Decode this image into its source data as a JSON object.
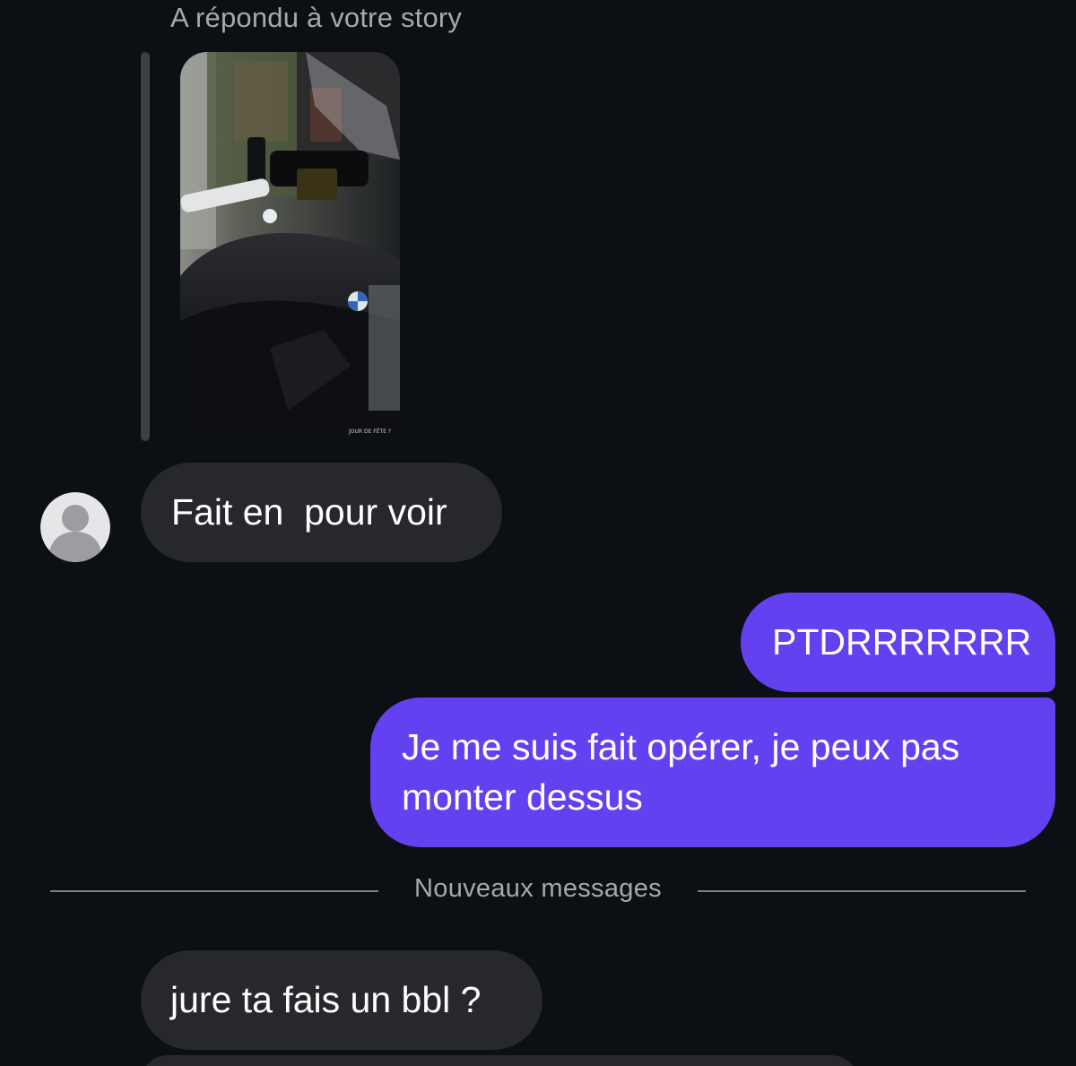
{
  "story_reply": {
    "caption": "A répondu à votre story",
    "thumbnail_icon": "motorcycle-story-image",
    "thumbnail_overlay_text": "JOUR DE FÊTE ?"
  },
  "avatar": {
    "icon": "default-user-avatar-icon"
  },
  "messages": [
    {
      "direction": "incoming",
      "text": "Fait en  pour voir"
    },
    {
      "direction": "outgoing",
      "text": "PTDRRRRRRR"
    },
    {
      "direction": "outgoing",
      "text": "Je me suis fait opérer, je peux pas\nmonter dessus"
    },
    {
      "direction": "incoming",
      "text": "jure ta fais un bbl ?"
    }
  ],
  "divider": {
    "label": "Nouveaux messages"
  },
  "colors": {
    "background": "#0c0f14",
    "incoming_bubble": "#26282c",
    "outgoing_bubble": "#6441f0",
    "muted_text": "#a6a8ad"
  }
}
